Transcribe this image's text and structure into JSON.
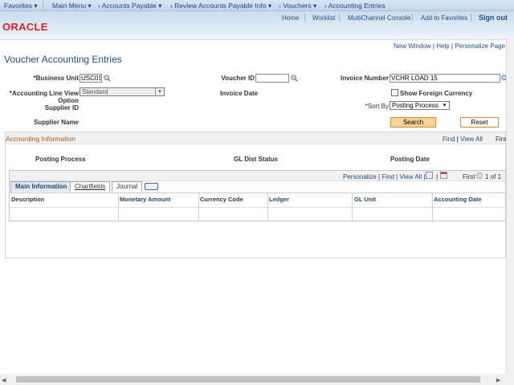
{
  "nav": {
    "favorites": "Favorites",
    "main_menu": "Main Menu",
    "breadcrumbs": [
      "Accounts Payable",
      "Review Accounts Payable Info",
      "Vouchers",
      "Accounting Entries"
    ]
  },
  "header": {
    "links": [
      "Home",
      "Worklist",
      "MultiChannel Console",
      "Add to Favorites"
    ],
    "signout": "Sign out",
    "logo": "ORACLE"
  },
  "page_links": [
    "New Window",
    "Help",
    "Personalize Page"
  ],
  "title": "Voucher Accounting Entries",
  "form": {
    "business_unit_label": "*Business Unit",
    "business_unit": "USC01",
    "voucher_id_label": "Voucher ID",
    "voucher_id": "",
    "invoice_number_label": "Invoice Number",
    "invoice_number": "VCHR LOAD 15",
    "acct_line_label": "*Accounting Line View",
    "acct_line_label2": "Option",
    "acct_line_value": "Standard",
    "invoice_date_label": "Invoice Date",
    "show_foreign_label": "Show Foreign Currency",
    "show_foreign_checked": false,
    "supplier_id_label": "Supplier ID",
    "sort_by_label": "*Sort By",
    "sort_by_value": "Posting Process",
    "supplier_name_label": "Supplier Name",
    "search": "Search",
    "reset": "Reset"
  },
  "accounting": {
    "title": "Accounting Information",
    "find": "Find",
    "view_all": "View All",
    "first": "Firs",
    "fields": [
      "Posting Process",
      "GL Dist Status",
      "Posting Date"
    ]
  },
  "grid": {
    "personalize": "Personalize",
    "find": "Find",
    "view_all": "View All",
    "first": "First",
    "count": "1 of 1",
    "tabs": [
      "Main Information",
      "Chartfields",
      "Journal"
    ],
    "columns": [
      "Description",
      "Monetary Amount",
      "Currency Code",
      "Ledger",
      "GL Unit",
      "Accounting Date"
    ]
  },
  "colors": {
    "accent": "#1a4f86",
    "section_title": "#b05a1a",
    "search_button": "#fbd397"
  }
}
